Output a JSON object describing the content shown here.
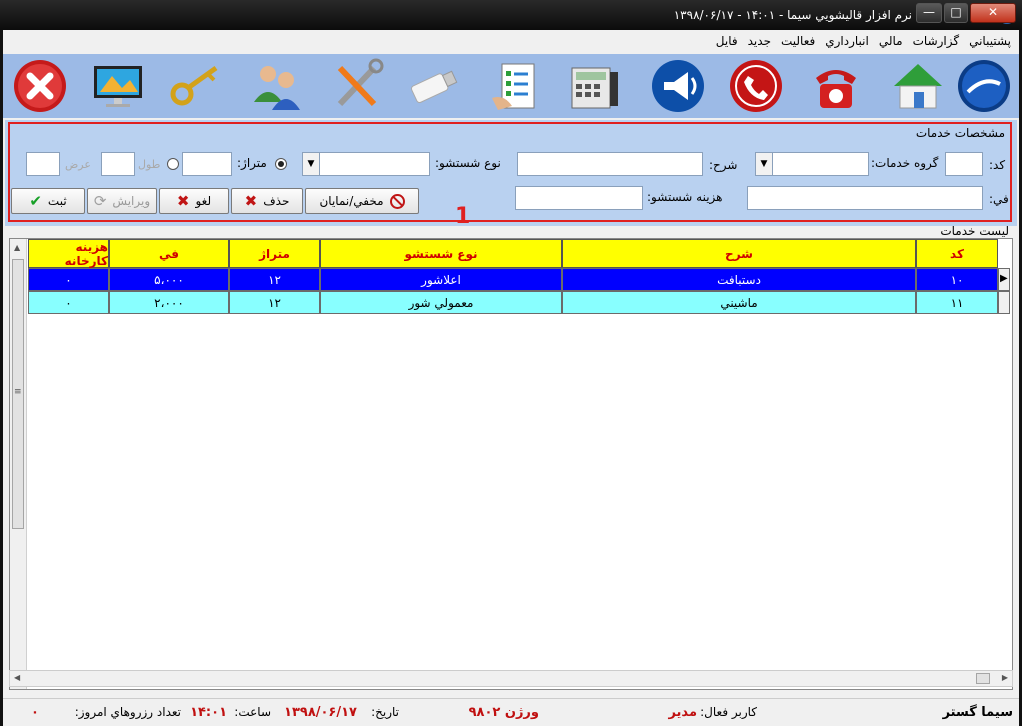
{
  "window": {
    "title": "نرم افزار قاليشويي سيما   -   ۱۴:۰۱   -   ۱۳۹۸/۰۶/۱۷",
    "minimize": "—",
    "maximize": "□",
    "close": "✕"
  },
  "menu": [
    "فايل",
    "جديد",
    "فعاليت",
    "انبارداري",
    "مالي",
    "گزارشات",
    "پشتيباني"
  ],
  "toolbar": {
    "items": [
      "sima-logo-icon",
      "home-icon",
      "phone-icon",
      "call-icon",
      "megaphone-icon",
      "calculator-icon",
      "checklist-icon",
      "usb-drive-icon",
      "tools-icon",
      "users-icon",
      "key-icon",
      "monitor-icon",
      "exit-icon"
    ]
  },
  "services": {
    "title": "مشخصات خدمات",
    "code_label": "كد:",
    "group_label": "گروه خدمات:",
    "desc_label": "شرح:",
    "wash_type_label": "نوع شستشو:",
    "meterage_label": "متراژ:",
    "length_label": "طول",
    "width_label": "عرض",
    "fee_label": "في:",
    "wash_cost_label": "هزينه شستشو:",
    "btn_toggle": "مخفي/نمايان",
    "btn_delete": "حذف",
    "btn_cancel": "لغو",
    "btn_edit": "ويرايش",
    "btn_save": "ثبت",
    "marker": "1"
  },
  "list": {
    "title": "ليست خدمات",
    "columns": [
      "كد",
      "شرح",
      "نوع شستشو",
      "متراژ",
      "في",
      "هزينه كارخانه"
    ],
    "rows": [
      [
        "۱۰",
        "دستبافت",
        "اعلاشور",
        "۱۲",
        "۵،۰۰۰",
        "۰"
      ],
      [
        "۱۱",
        "ماشيني",
        "معمولي شور",
        "۱۲",
        "۲،۰۰۰",
        "۰"
      ]
    ]
  },
  "status": {
    "brand": "سيما گستر",
    "user_label": "كاربر فعال:",
    "user": "مدير",
    "version": "ورژن ۹۸۰۲",
    "date_label": "تاريخ:",
    "date": "۱۳۹۸/۰۶/۱۷",
    "time_label": "ساعت:",
    "time": "۱۴:۰۱",
    "reserve_label": "تعداد رزروهاي امروز:",
    "reserve_count": "۰"
  },
  "colors": {
    "toolbar_bg": "#9cbae6",
    "panel_bg": "#b9d1f0",
    "header_bg": "#ffff00",
    "header_text": "#d00000",
    "selected_row": "#0000ff",
    "row_alt": "#88ffff",
    "highlight_border": "#e02020"
  }
}
